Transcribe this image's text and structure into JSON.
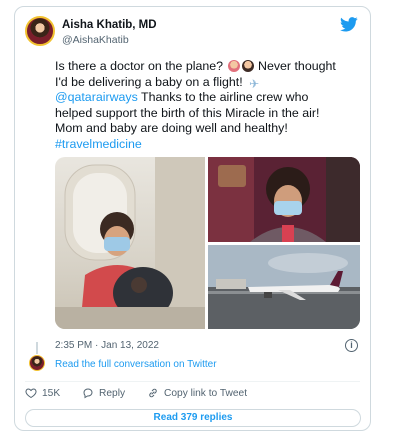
{
  "author": {
    "name": "Aisha Khatib, MD",
    "handle": "@AishaKhatib"
  },
  "tweet": {
    "line1": "Is there a doctor on the plane?",
    "line1_end": "Never thought",
    "line2": "I'd be delivering a baby on a flight!",
    "mention": "@qatarairways",
    "line3_rest": " Thanks to the airline crew who",
    "line4": "helped support the birth of this Miracle in the air!",
    "line5": "Mom and baby are doing well and healthy!",
    "hashtag": "#travelmedicine"
  },
  "timestamp": "2:35 PM · Jan 13, 2022",
  "conversation_link": "Read the full conversation on Twitter",
  "actions": {
    "likes": "15K",
    "reply": "Reply",
    "copy_link": "Copy link to Tweet"
  },
  "read_replies": "Read 379 replies",
  "colors": {
    "link": "#1d9bf0",
    "text": "#0f1419",
    "secondary": "#536471",
    "like": "#f91880"
  },
  "icons": [
    "twitter-bird-icon",
    "info-icon",
    "heart-icon",
    "reply-bubble-icon",
    "link-icon"
  ]
}
